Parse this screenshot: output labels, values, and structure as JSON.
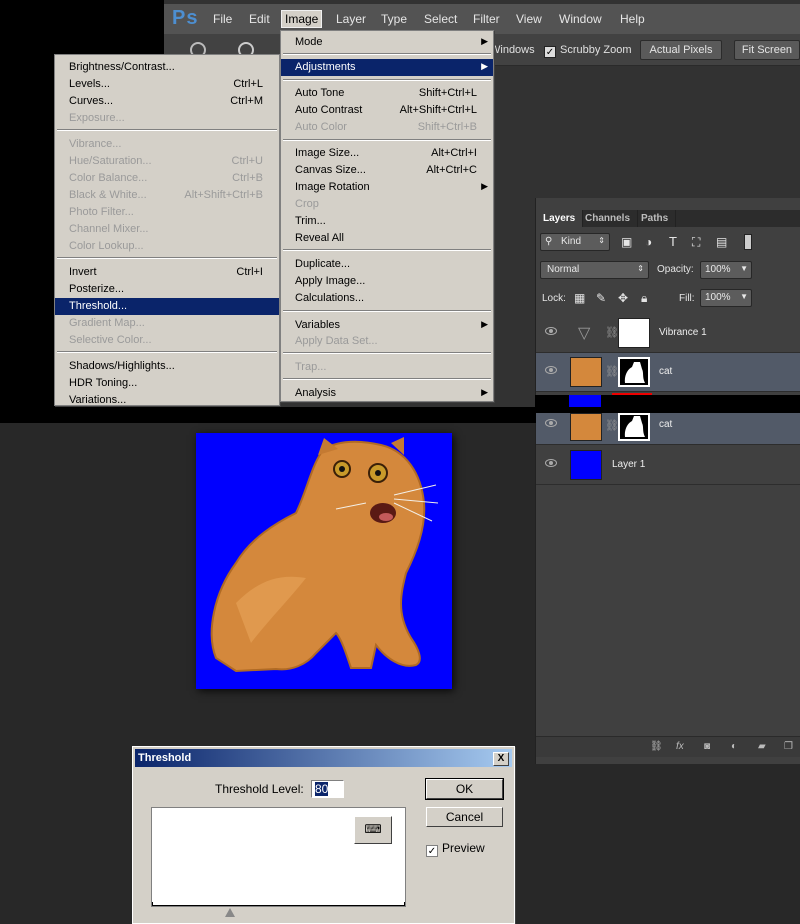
{
  "menubar": {
    "logo": "Ps",
    "items": [
      "File",
      "Edit",
      "Image",
      "Layer",
      "Type",
      "Select",
      "Filter",
      "View",
      "Window",
      "Help"
    ]
  },
  "options_bar": {
    "windows_partial": "Windows",
    "scrubby_zoom": "Scrubby Zoom",
    "actual_pixels": "Actual Pixels",
    "fit_screen": "Fit Screen"
  },
  "image_menu": {
    "items": [
      {
        "label": "Mode",
        "shortcut": "",
        "submenu": true,
        "disabled": false
      },
      {
        "label": "Adjustments",
        "shortcut": "",
        "submenu": true,
        "disabled": false,
        "highlighted": true
      },
      {
        "label": "Auto Tone",
        "shortcut": "Shift+Ctrl+L",
        "disabled": false
      },
      {
        "label": "Auto Contrast",
        "shortcut": "Alt+Shift+Ctrl+L",
        "disabled": false
      },
      {
        "label": "Auto Color",
        "shortcut": "Shift+Ctrl+B",
        "disabled": true
      },
      {
        "label": "Image Size...",
        "shortcut": "Alt+Ctrl+I",
        "disabled": false
      },
      {
        "label": "Canvas Size...",
        "shortcut": "Alt+Ctrl+C",
        "disabled": false
      },
      {
        "label": "Image Rotation",
        "shortcut": "",
        "submenu": true,
        "disabled": false
      },
      {
        "label": "Crop",
        "shortcut": "",
        "disabled": true
      },
      {
        "label": "Trim...",
        "shortcut": "",
        "disabled": false
      },
      {
        "label": "Reveal All",
        "shortcut": "",
        "disabled": false
      },
      {
        "label": "Duplicate...",
        "shortcut": "",
        "disabled": false
      },
      {
        "label": "Apply Image...",
        "shortcut": "",
        "disabled": false
      },
      {
        "label": "Calculations...",
        "shortcut": "",
        "disabled": false
      },
      {
        "label": "Variables",
        "shortcut": "",
        "submenu": true,
        "disabled": false
      },
      {
        "label": "Apply Data Set...",
        "shortcut": "",
        "disabled": true
      },
      {
        "label": "Trap...",
        "shortcut": "",
        "disabled": true
      },
      {
        "label": "Analysis",
        "shortcut": "",
        "submenu": true,
        "disabled": false
      }
    ]
  },
  "adjustments_menu": {
    "items": [
      {
        "label": "Brightness/Contrast...",
        "shortcut": "",
        "disabled": false
      },
      {
        "label": "Levels...",
        "shortcut": "Ctrl+L",
        "disabled": false
      },
      {
        "label": "Curves...",
        "shortcut": "Ctrl+M",
        "disabled": false
      },
      {
        "label": "Exposure...",
        "shortcut": "",
        "disabled": true
      },
      {
        "label": "Vibrance...",
        "shortcut": "",
        "disabled": true
      },
      {
        "label": "Hue/Saturation...",
        "shortcut": "Ctrl+U",
        "disabled": true
      },
      {
        "label": "Color Balance...",
        "shortcut": "Ctrl+B",
        "disabled": true
      },
      {
        "label": "Black & White...",
        "shortcut": "Alt+Shift+Ctrl+B",
        "disabled": true
      },
      {
        "label": "Photo Filter...",
        "shortcut": "",
        "disabled": true
      },
      {
        "label": "Channel Mixer...",
        "shortcut": "",
        "disabled": true
      },
      {
        "label": "Color Lookup...",
        "shortcut": "",
        "disabled": true
      },
      {
        "label": "Invert",
        "shortcut": "Ctrl+I",
        "disabled": false
      },
      {
        "label": "Posterize...",
        "shortcut": "",
        "disabled": false
      },
      {
        "label": "Threshold...",
        "shortcut": "",
        "disabled": false,
        "highlighted": true
      },
      {
        "label": "Gradient Map...",
        "shortcut": "",
        "disabled": true
      },
      {
        "label": "Selective Color...",
        "shortcut": "",
        "disabled": true
      },
      {
        "label": "Shadows/Highlights...",
        "shortcut": "",
        "disabled": false
      },
      {
        "label": "HDR Toning...",
        "shortcut": "",
        "disabled": false
      },
      {
        "label": "Variations...",
        "shortcut": "",
        "disabled": false
      }
    ]
  },
  "layers_panel": {
    "tabs": [
      "Layers",
      "Channels",
      "Paths"
    ],
    "filter_kind": "Kind",
    "blend_mode": "Normal",
    "opacity_label": "Opacity:",
    "opacity_value": "100%",
    "lock_label": "Lock:",
    "fill_label": "Fill:",
    "fill_value": "100%",
    "layers": [
      {
        "name": "Vibrance 1",
        "type": "adjustment"
      },
      {
        "name": "cat",
        "type": "masked",
        "selected": true
      },
      {
        "name": "cat",
        "type": "masked",
        "selected": true
      },
      {
        "name": "Layer 1",
        "type": "fill"
      }
    ]
  },
  "dialog": {
    "title": "Threshold",
    "close": "X",
    "threshold_label": "Threshold Level:",
    "threshold_value": "80",
    "ok": "OK",
    "cancel": "Cancel",
    "preview": "Preview",
    "preview_checked": true
  },
  "colors": {
    "menu_highlight": "#0a246a",
    "canvas_bg": "#0000ff",
    "cat_fur": "#d88a3e"
  }
}
